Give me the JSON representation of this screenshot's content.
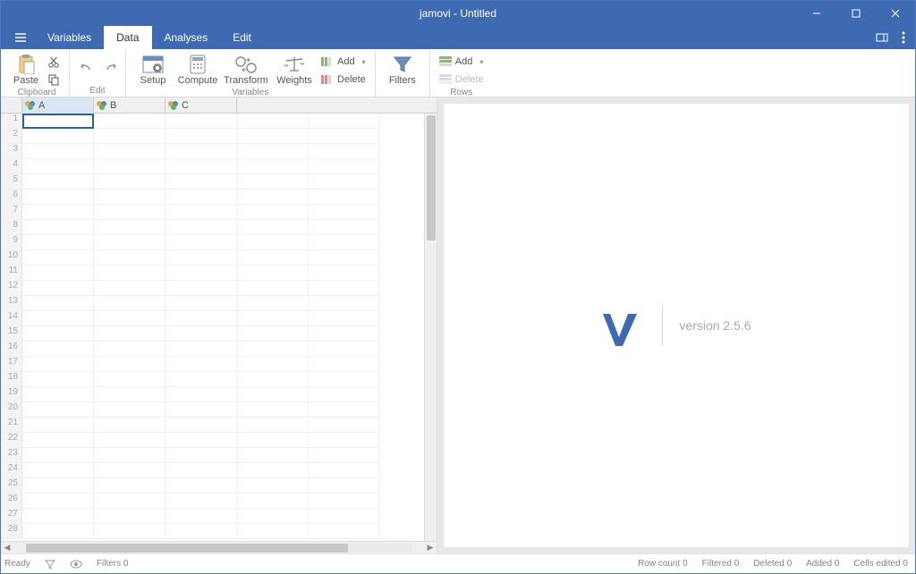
{
  "titlebar": {
    "title": "jamovi - Untitled"
  },
  "tabs": {
    "variables": "Variables",
    "data": "Data",
    "analyses": "Analyses",
    "edit": "Edit",
    "active": "data"
  },
  "ribbon": {
    "clipboard_group": "Clipboard",
    "edit_group": "Edit",
    "variables_group": "Variables",
    "rows_group": "Rows",
    "paste": "Paste",
    "setup": "Setup",
    "compute": "Compute",
    "transform": "Transform",
    "weights": "Weights",
    "filters": "Filters",
    "add": "Add",
    "delete": "Delete"
  },
  "columns": {
    "a": "A",
    "b": "B",
    "c": "C"
  },
  "output": {
    "version_label": "version 2.5.6"
  },
  "status": {
    "ready": "Ready",
    "filters": "Filters 0",
    "row_count": "Row count 0",
    "filtered": "Filtered 0",
    "deleted": "Deleted 0",
    "added": "Added 0",
    "cells_edited": "Cells edited 0"
  }
}
